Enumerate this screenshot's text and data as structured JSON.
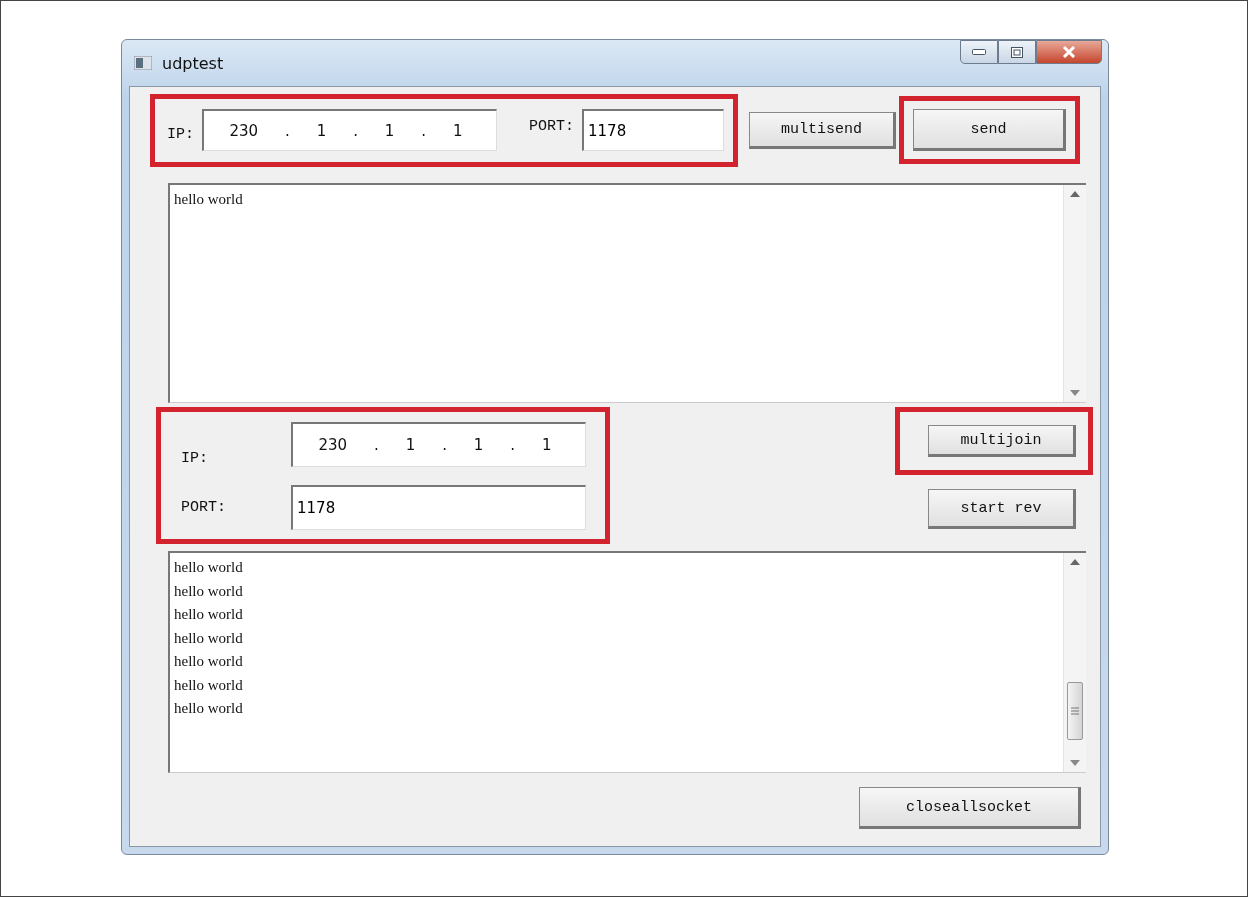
{
  "window": {
    "title": "udptest"
  },
  "send_group": {
    "highlighted": true,
    "ip_label": "IP:",
    "ip_parts": [
      "230",
      ".",
      "1",
      ".",
      "1",
      ".",
      "1"
    ],
    "port_label": "PORT:",
    "port": "1178"
  },
  "multisend_button": {
    "label": "multisend",
    "highlighted": false
  },
  "send_button": {
    "label": "send",
    "highlighted": true
  },
  "send_text": {
    "lines": [
      "hello world"
    ]
  },
  "receive_group": {
    "highlighted": true,
    "ip_label": "IP:",
    "ip_parts": [
      "230",
      ".",
      "1",
      ".",
      "1",
      ".",
      "1"
    ],
    "port_label": "PORT:",
    "port": "1178"
  },
  "multijoin_button": {
    "label": "multijoin",
    "highlighted": true
  },
  "start_button": {
    "label": "start rev",
    "highlighted": false
  },
  "receive_text": {
    "lines": [
      "hello world",
      "hello world",
      "hello world",
      "hello world",
      "hello world",
      "hello world",
      "hello world"
    ]
  },
  "close_button": {
    "label": "closeallsocket"
  }
}
